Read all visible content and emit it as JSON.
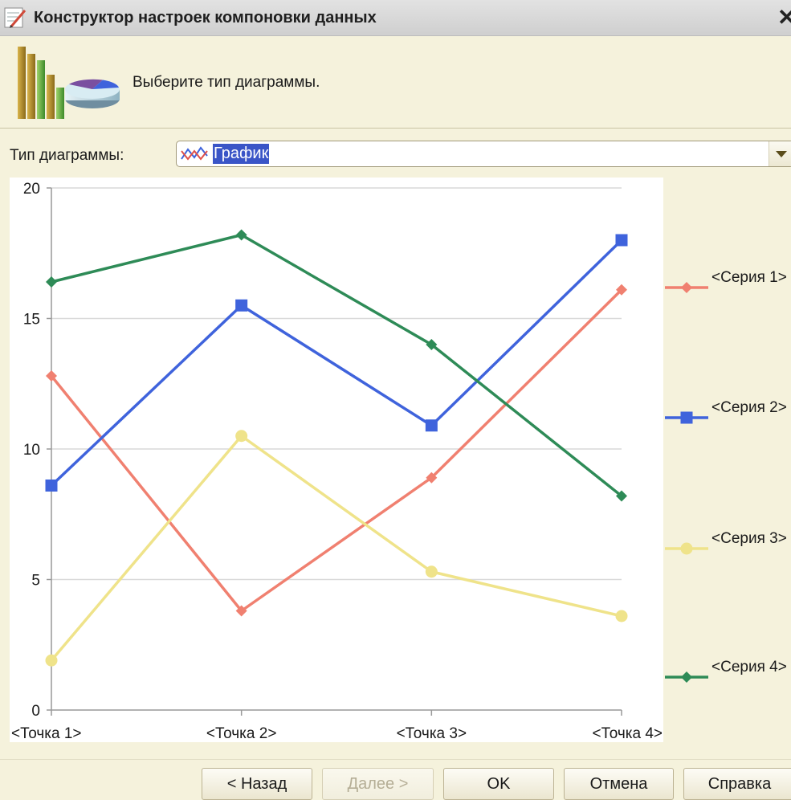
{
  "window": {
    "title": "Конструктор настроек компоновки данных"
  },
  "header": {
    "prompt": "Выберите тип диаграммы."
  },
  "chart_type": {
    "label": "Тип диаграммы:",
    "selected": "График"
  },
  "chart_data": {
    "type": "line",
    "categories": [
      "<Точка 1>",
      "<Точка 2>",
      "<Точка 3>",
      "<Точка 4>"
    ],
    "series": [
      {
        "name": "<Серия 1>",
        "values": [
          12.8,
          3.8,
          8.9,
          16.1
        ],
        "color": "#f08070",
        "marker": "diamond"
      },
      {
        "name": "<Серия 2>",
        "values": [
          8.6,
          15.5,
          10.9,
          18.0
        ],
        "color": "#3f63dc",
        "marker": "square"
      },
      {
        "name": "<Серия 3>",
        "values": [
          1.9,
          10.5,
          5.3,
          3.6
        ],
        "color": "#efe38a",
        "marker": "circle"
      },
      {
        "name": "<Серия 4>",
        "values": [
          16.4,
          18.2,
          14.0,
          8.2
        ],
        "color": "#2e8b57",
        "marker": "diamond"
      }
    ],
    "yticks": [
      "0",
      "5",
      "10",
      "15",
      "20"
    ],
    "ylim": [
      0,
      20
    ],
    "grid": true,
    "legend": "right"
  },
  "buttons": {
    "back": "< Назад",
    "next": "Далее >",
    "ok": "OK",
    "cancel": "Отмена",
    "help": "Справка"
  }
}
